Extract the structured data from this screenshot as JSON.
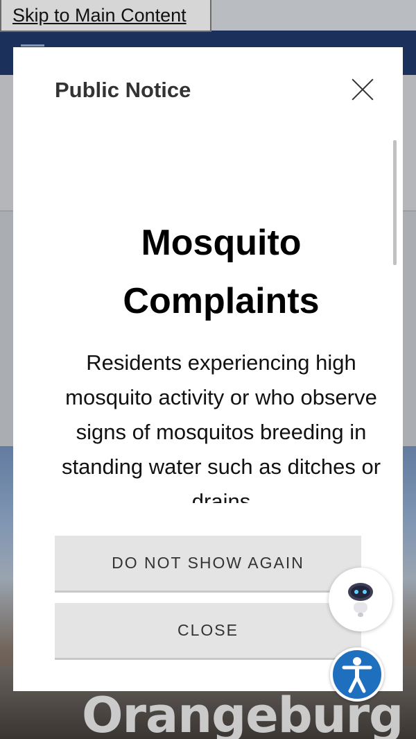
{
  "skip_link": {
    "label": "Skip to Main Content"
  },
  "background": {
    "city_wordmark": "Orangeburg"
  },
  "modal": {
    "title": "Public Notice",
    "close_icon": "close-icon",
    "content": {
      "heading": "Mosquito Complaints",
      "body": "Residents experiencing high mosquito activity or who observe signs of mosquitos breeding in standing water such as ditches or drains"
    },
    "buttons": {
      "do_not_show_again": "DO NOT SHOW AGAIN",
      "close": "CLOSE"
    }
  },
  "widgets": {
    "chatbot_icon": "robot-icon",
    "accessibility_icon": "accessibility-icon"
  },
  "colors": {
    "header_navy": "#1e3664",
    "button_gray": "#e4e4e4",
    "accessibility_blue": "#1f6fbf"
  }
}
